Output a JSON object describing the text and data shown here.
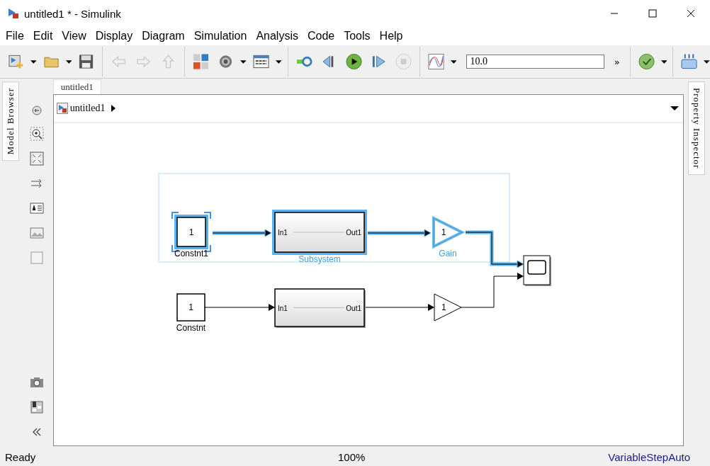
{
  "window": {
    "title": "untitled1 * - Simulink"
  },
  "menu": [
    "File",
    "Edit",
    "View",
    "Display",
    "Diagram",
    "Simulation",
    "Analysis",
    "Code",
    "Tools",
    "Help"
  ],
  "toolbar": {
    "stop_time": "10.0",
    "overflow": "»"
  },
  "side_tabs": {
    "left": "Model Browser",
    "right": "Property Inspector"
  },
  "editor_tab": {
    "label": "untitled1",
    "selected": true
  },
  "breadcrumb": {
    "path": "untitled1"
  },
  "blocks": [
    {
      "kind": "constant",
      "value": "1",
      "label": "Constnt1",
      "selected": true
    },
    {
      "kind": "subsystem",
      "in_port": "In1",
      "out_port": "Out1",
      "label": "Subsystem",
      "selected": true
    },
    {
      "kind": "gain",
      "value": "1",
      "label": "Gain",
      "selected": true
    },
    {
      "kind": "scope",
      "selected": false
    },
    {
      "kind": "constant",
      "value": "1",
      "label": "Constnt",
      "selected": false
    },
    {
      "kind": "subsystem",
      "in_port": "In1",
      "out_port": "Out1",
      "selected": false
    },
    {
      "kind": "gain",
      "value": "1",
      "selected": false
    }
  ],
  "status_bar": {
    "state": "Ready",
    "zoom": "100%",
    "solver": "VariableStepAuto"
  }
}
